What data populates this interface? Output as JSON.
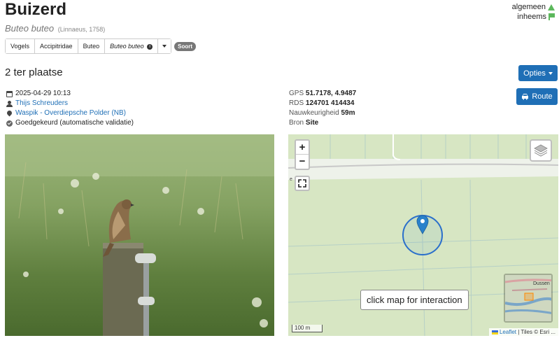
{
  "species": {
    "name": "Buizerd",
    "scientific": "Buteo buteo",
    "author": "(Linnaeus, 1758)"
  },
  "status": {
    "frequency": "algemeen",
    "origin": "inheems",
    "color": "#5cb85c"
  },
  "taxonomy": {
    "items": [
      "Vogels",
      "Accipitridae",
      "Buteo",
      "Buteo buteo"
    ],
    "rank_badge": "Soort"
  },
  "observation": {
    "title": "2 ter plaatse",
    "datetime": "2025-04-29 10:13",
    "observer": "Thijs Schreuders",
    "location": "Waspik - Overdiepsche Polder (NB)",
    "validation": "Goedgekeurd (automatische validatie)"
  },
  "geo": {
    "gps_label": "GPS",
    "gps_value": "51.7178, 4.9487",
    "rds_label": "RDS",
    "rds_value": "124701 414434",
    "accuracy_label": "Nauwkeurigheid",
    "accuracy_value": "59m",
    "source_label": "Bron",
    "source_value": "Site"
  },
  "buttons": {
    "options": "Opties",
    "route": "Route"
  },
  "map": {
    "zoom_in": "+",
    "zoom_out": "−",
    "overlay_text": "click map for interaction",
    "scale": "100 m",
    "attribution_link": "Leaflet",
    "attribution_rest": "| Tiles © Esri ...",
    "minimap_label": "Dussen",
    "edge_label": "e"
  },
  "colors": {
    "accent": "#1f6fb6",
    "marker": "#2a81cb"
  }
}
